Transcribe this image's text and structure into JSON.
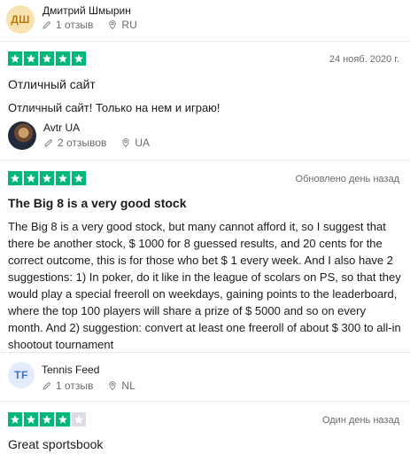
{
  "reviews": [
    {
      "initials": "ДШ",
      "name": "Дмитрий Шмырин",
      "reviews_count": "1 отзыв",
      "country": "RU",
      "rating": 5,
      "date": "24 нояб. 2020 г.",
      "title": "Отличный сайт",
      "text": "Отличный сайт! Только на нем и играю!"
    },
    {
      "name": "Avtr UA",
      "reviews_count": "2 отзывов",
      "country": "UA",
      "rating": 5,
      "date": "Обновлено день назад",
      "title": "The Big 8 is a very good stock",
      "text": "The Big 8 is a very good stock, but many cannot afford it, so I suggest that there be another stock, $ 1000 for 8 guessed results, and 20 cents for the correct outcome, this is for those who bet $ 1 every week. And I also have 2 suggestions: 1) In poker, do it like in the league of scolars on PS, so that they would play a special freeroll on weekdays, gaining points to the leaderboard, where the top 100 players will share a prize of $ 5000 and so on every month. And 2) suggestion: convert at least one freeroll of about $ 300 to all-in shootout tournament"
    },
    {
      "initials": "TF",
      "name": "Tennis Feed",
      "reviews_count": "1 отзыв",
      "country": "NL",
      "rating": 4,
      "date": "Один день назад",
      "title": "Great sportsbook"
    }
  ]
}
